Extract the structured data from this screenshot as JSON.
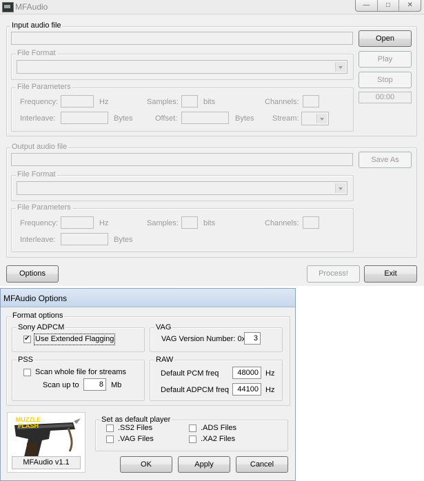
{
  "main": {
    "title": "MFAudio",
    "caption": {
      "min": "—",
      "max": "□",
      "close": "✕"
    },
    "input": {
      "group_label": "Input audio file",
      "format_label": "File Format",
      "params_label": "File Parameters",
      "frequency_label": "Frequency:",
      "hz_unit": "Hz",
      "samples_label": "Samples:",
      "bits_unit": "bits",
      "channels_label": "Channels:",
      "interleave_label": "Interleave:",
      "bytes_unit": "Bytes",
      "offset_label": "Offset:",
      "offset_bytes_unit": "Bytes",
      "stream_label": "Stream:"
    },
    "output": {
      "group_label": "Output audio file",
      "format_label": "File Format",
      "params_label": "File Parameters",
      "frequency_label": "Frequency:",
      "hz_unit": "Hz",
      "samples_label": "Samples:",
      "bits_unit": "bits",
      "channels_label": "Channels:",
      "interleave_label": "Interleave:",
      "bytes_unit": "Bytes"
    },
    "buttons": {
      "open": "Open",
      "play": "Play",
      "stop": "Stop",
      "time": "00:00",
      "save_as": "Save As",
      "options": "Options",
      "process": "Process!",
      "exit": "Exit"
    }
  },
  "options_dialog": {
    "title": "MFAudio Options",
    "format_options_label": "Format options",
    "sony_adpcm": {
      "label": "Sony ADPCM",
      "use_extended_flagging": "Use Extended Flagging",
      "use_extended_flagging_checked": true
    },
    "vag": {
      "label": "VAG",
      "version_label": "VAG Version Number: 0x",
      "version_value": "3"
    },
    "pss": {
      "label": "PSS",
      "scan_whole_file": "Scan whole file for streams",
      "scan_whole_file_checked": false,
      "scan_up_to_label": "Scan up to",
      "scan_up_to_value": "8",
      "scan_unit": "Mb"
    },
    "raw": {
      "label": "RAW",
      "pcm_label": "Default PCM freq",
      "pcm_value": "48000",
      "pcm_unit": "Hz",
      "adpcm_label": "Default ADPCM freq",
      "adpcm_value": "44100",
      "adpcm_unit": "Hz"
    },
    "logo_text": "MUZZLE FLASH",
    "version_text": "MFAudio v1.1",
    "default_player": {
      "label": "Set as default player",
      "ss2": ".SS2 Files",
      "vag": ".VAG Files",
      "ads": ".ADS Files",
      "xa2": ".XA2 Files"
    },
    "buttons": {
      "ok": "OK",
      "apply": "Apply",
      "cancel": "Cancel"
    }
  }
}
